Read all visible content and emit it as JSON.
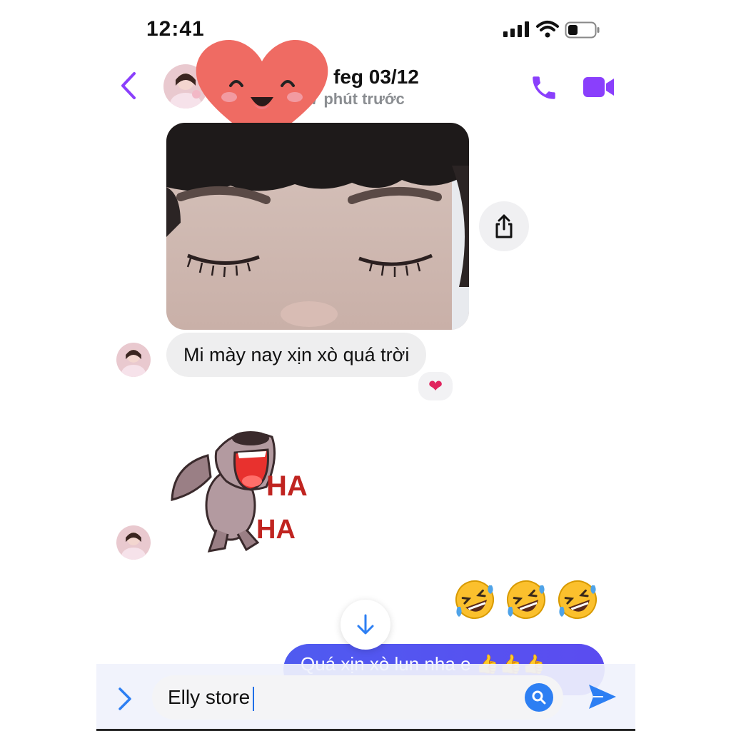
{
  "status_bar": {
    "time": "12:41"
  },
  "header": {
    "contact_name": "feg 03/12",
    "last_active": "7 phút trước"
  },
  "messages": {
    "incoming_text": "Mi mày nay xịn xò quá trời",
    "reaction": "❤",
    "sticker_text_1": "HA",
    "sticker_text_2": "HA",
    "outgoing_text": "Quá xịn xò lun nha e 👍👍👍"
  },
  "composer": {
    "value": "Elly store"
  },
  "colors": {
    "accent_purple": "#8a3ffc",
    "accent_blue": "#2d7ff3",
    "bubble_in": "#eeeeef",
    "bubble_out": "#4f5bf0",
    "heart": "#ef6b63"
  },
  "icons": [
    "back-chevron-icon",
    "phone-icon",
    "video-icon",
    "share-icon",
    "scroll-down-arrow-icon",
    "expand-chevron-icon",
    "search-lens-icon",
    "send-icon"
  ]
}
